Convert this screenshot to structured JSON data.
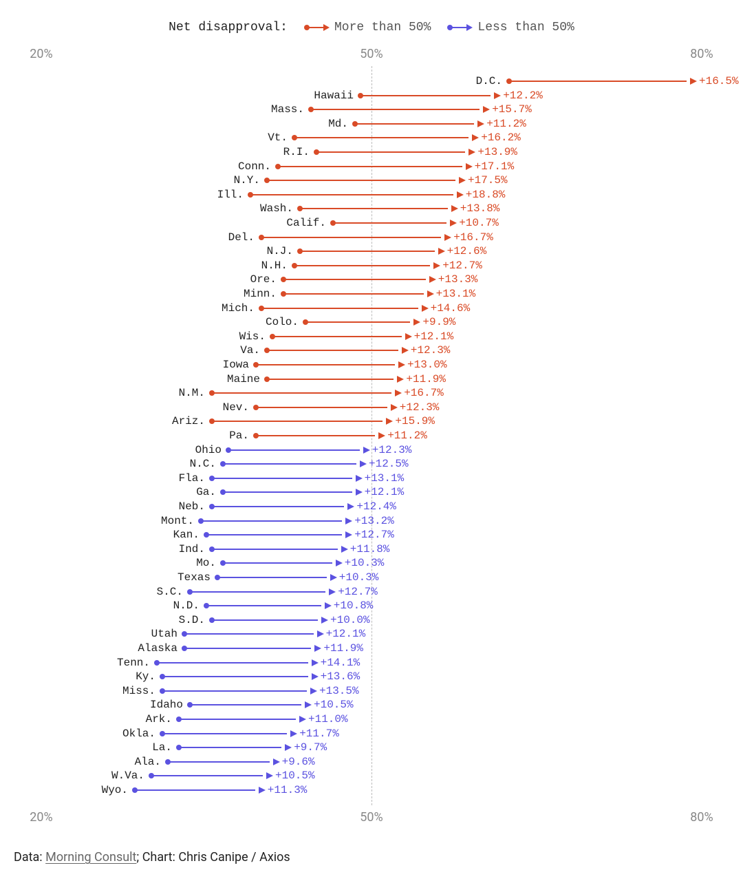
{
  "legend": {
    "title": "Net disapproval:",
    "more": "More than 50%",
    "less": "Less than 50%"
  },
  "colors": {
    "more": "#d94b27",
    "less": "#5b52e0"
  },
  "axis": {
    "t20": "20%",
    "t50": "50%",
    "t80": "80%"
  },
  "credit": {
    "prefix": "Data: ",
    "source": "Morning Consult",
    "sep": "; ",
    "rest": "Chart: Chris Canipe / Axios"
  },
  "chart_data": {
    "type": "dot-arrow",
    "xlabel": "",
    "ylabel": "",
    "xlim": [
      20,
      80
    ],
    "title": "",
    "note": "x_end = start + change. Group 'more' means x_end > 50, 'less' means x_end < 50.",
    "rows": [
      {
        "state": "D.C.",
        "start": 62.5,
        "change": 16.5,
        "group": "more"
      },
      {
        "state": "Hawaii",
        "start": 49.0,
        "change": 12.2,
        "group": "more"
      },
      {
        "state": "Mass.",
        "start": 44.5,
        "change": 15.7,
        "group": "more"
      },
      {
        "state": "Md.",
        "start": 48.5,
        "change": 11.2,
        "group": "more"
      },
      {
        "state": "Vt.",
        "start": 43.0,
        "change": 16.2,
        "group": "more"
      },
      {
        "state": "R.I.",
        "start": 45.0,
        "change": 13.9,
        "group": "more"
      },
      {
        "state": "Conn.",
        "start": 41.5,
        "change": 17.1,
        "group": "more"
      },
      {
        "state": "N.Y.",
        "start": 40.5,
        "change": 17.5,
        "group": "more"
      },
      {
        "state": "Ill.",
        "start": 39.0,
        "change": 18.8,
        "group": "more"
      },
      {
        "state": "Wash.",
        "start": 43.5,
        "change": 13.8,
        "group": "more"
      },
      {
        "state": "Calif.",
        "start": 46.5,
        "change": 10.7,
        "group": "more"
      },
      {
        "state": "Del.",
        "start": 40.0,
        "change": 16.7,
        "group": "more"
      },
      {
        "state": "N.J.",
        "start": 43.5,
        "change": 12.6,
        "group": "more"
      },
      {
        "state": "N.H.",
        "start": 43.0,
        "change": 12.7,
        "group": "more"
      },
      {
        "state": "Ore.",
        "start": 42.0,
        "change": 13.3,
        "group": "more"
      },
      {
        "state": "Minn.",
        "start": 42.0,
        "change": 13.1,
        "group": "more"
      },
      {
        "state": "Mich.",
        "start": 40.0,
        "change": 14.6,
        "group": "more"
      },
      {
        "state": "Colo.",
        "start": 44.0,
        "change": 9.9,
        "group": "more"
      },
      {
        "state": "Wis.",
        "start": 41.0,
        "change": 12.1,
        "group": "more"
      },
      {
        "state": "Va.",
        "start": 40.5,
        "change": 12.3,
        "group": "more"
      },
      {
        "state": "Iowa",
        "start": 39.5,
        "change": 13.0,
        "group": "more"
      },
      {
        "state": "Maine",
        "start": 40.5,
        "change": 11.9,
        "group": "more"
      },
      {
        "state": "N.M.",
        "start": 35.5,
        "change": 16.7,
        "group": "more"
      },
      {
        "state": "Nev.",
        "start": 39.5,
        "change": 12.3,
        "group": "more"
      },
      {
        "state": "Ariz.",
        "start": 35.5,
        "change": 15.9,
        "group": "more"
      },
      {
        "state": "Pa.",
        "start": 39.5,
        "change": 11.2,
        "group": "more"
      },
      {
        "state": "Ohio",
        "start": 37.0,
        "change": 12.3,
        "group": "less"
      },
      {
        "state": "N.C.",
        "start": 36.5,
        "change": 12.5,
        "group": "less"
      },
      {
        "state": "Fla.",
        "start": 35.5,
        "change": 13.1,
        "group": "less"
      },
      {
        "state": "Ga.",
        "start": 36.5,
        "change": 12.1,
        "group": "less"
      },
      {
        "state": "Neb.",
        "start": 35.5,
        "change": 12.4,
        "group": "less"
      },
      {
        "state": "Mont.",
        "start": 34.5,
        "change": 13.2,
        "group": "less"
      },
      {
        "state": "Kan.",
        "start": 35.0,
        "change": 12.7,
        "group": "less"
      },
      {
        "state": "Ind.",
        "start": 35.5,
        "change": 11.8,
        "group": "less"
      },
      {
        "state": "Mo.",
        "start": 36.5,
        "change": 10.3,
        "group": "less"
      },
      {
        "state": "Texas",
        "start": 36.0,
        "change": 10.3,
        "group": "less"
      },
      {
        "state": "S.C.",
        "start": 33.5,
        "change": 12.7,
        "group": "less"
      },
      {
        "state": "N.D.",
        "start": 35.0,
        "change": 10.8,
        "group": "less"
      },
      {
        "state": "S.D.",
        "start": 35.5,
        "change": 10.0,
        "group": "less"
      },
      {
        "state": "Utah",
        "start": 33.0,
        "change": 12.1,
        "group": "less"
      },
      {
        "state": "Alaska",
        "start": 33.0,
        "change": 11.9,
        "group": "less"
      },
      {
        "state": "Tenn.",
        "start": 30.5,
        "change": 14.1,
        "group": "less"
      },
      {
        "state": "Ky.",
        "start": 31.0,
        "change": 13.6,
        "group": "less"
      },
      {
        "state": "Miss.",
        "start": 31.0,
        "change": 13.5,
        "group": "less"
      },
      {
        "state": "Idaho",
        "start": 33.5,
        "change": 10.5,
        "group": "less"
      },
      {
        "state": "Ark.",
        "start": 32.5,
        "change": 11.0,
        "group": "less"
      },
      {
        "state": "Okla.",
        "start": 31.0,
        "change": 11.7,
        "group": "less"
      },
      {
        "state": "La.",
        "start": 32.5,
        "change": 9.7,
        "group": "less"
      },
      {
        "state": "Ala.",
        "start": 31.5,
        "change": 9.6,
        "group": "less"
      },
      {
        "state": "W.Va.",
        "start": 30.0,
        "change": 10.5,
        "group": "less"
      },
      {
        "state": "Wyo.",
        "start": 28.5,
        "change": 11.3,
        "group": "less"
      }
    ]
  }
}
